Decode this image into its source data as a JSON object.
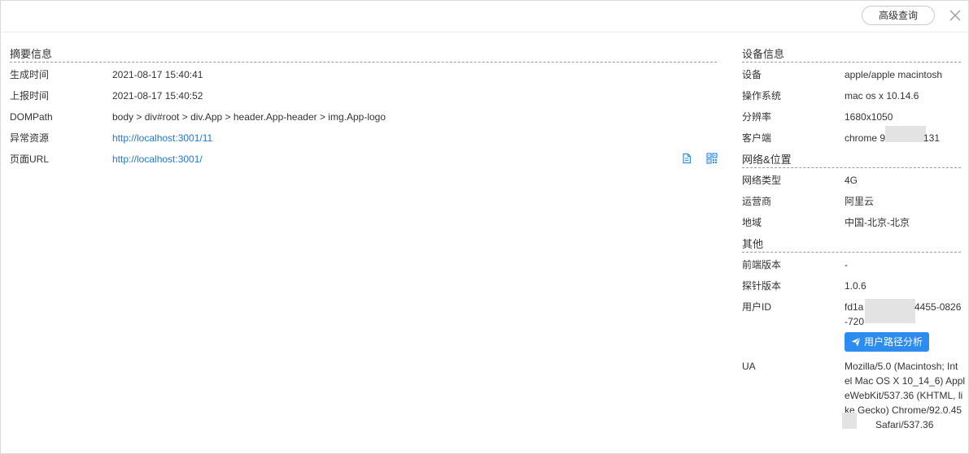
{
  "toolbar": {
    "advanced_query_label": "高级查询"
  },
  "summary": {
    "title": "摘要信息",
    "rows": [
      {
        "label": "生成时间",
        "value": "2021-08-17 15:40:41"
      },
      {
        "label": "上报时间",
        "value": "2021-08-17 15:40:52"
      },
      {
        "label": "DOMPath",
        "value": "body > div#root > div.App > header.App-header > img.App-logo"
      },
      {
        "label": "异常资源",
        "value": "http://localhost:3001/11"
      },
      {
        "label": "页面URL",
        "value": "http://localhost:3001/"
      }
    ]
  },
  "device": {
    "title": "设备信息",
    "rows": [
      {
        "label": "设备",
        "value": "apple/apple macintosh"
      },
      {
        "label": "操作系统",
        "value": "mac os x 10.14.6"
      },
      {
        "label": "分辨率",
        "value": "1680x1050"
      },
      {
        "label": "客户端",
        "value_a": "chrome 9",
        "value_b": "131"
      }
    ]
  },
  "network": {
    "title": "网络&位置",
    "rows": [
      {
        "label": "网络类型",
        "value": "4G"
      },
      {
        "label": "运营商",
        "value": "阿里云"
      },
      {
        "label": "地域",
        "value": "中国-北京-北京"
      }
    ]
  },
  "other": {
    "title": "其他",
    "frontend_version_label": "前端版本",
    "frontend_version_value": "-",
    "probe_version_label": "探针版本",
    "probe_version_value": "1.0.6",
    "user_id_label": "用户ID",
    "user_id_line1_a": "fd1a",
    "user_id_line1_b": "4455-0826",
    "user_id_line2": "-720",
    "user_path_button": "用户路径分析",
    "ua_label": "UA",
    "ua_lines": [
      "Mozilla/5.0 (Macintosh; Int",
      "el Mac OS X 10_14_6) Appl",
      "eWebKit/537.36 (KHTML, li",
      "ke Gecko) Chrome/92.0.45"
    ],
    "ua_last": "Safari/537.36"
  }
}
